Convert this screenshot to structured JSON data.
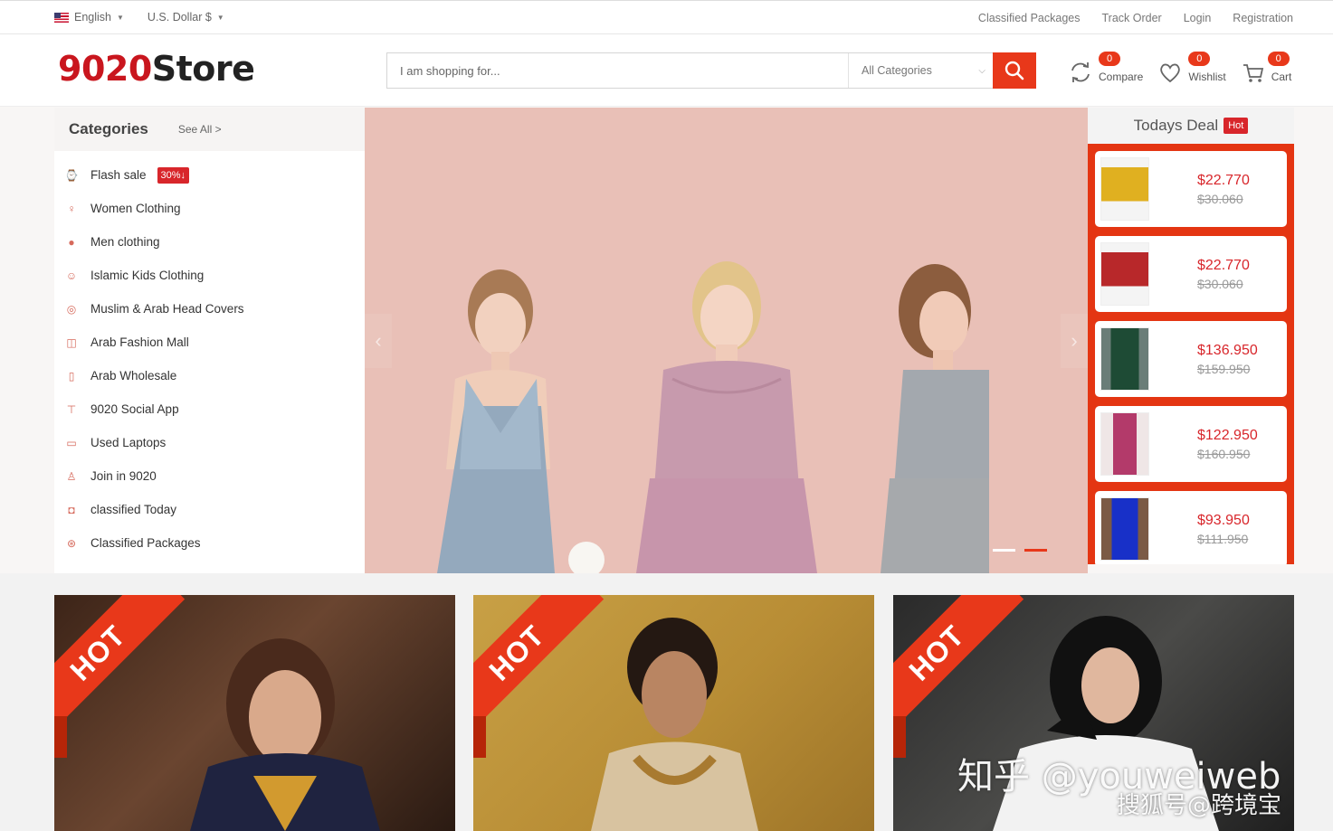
{
  "topbar": {
    "language": "English",
    "currency": "U.S. Dollar $",
    "links": [
      "Classified Packages",
      "Track Order",
      "Login",
      "Registration"
    ]
  },
  "header": {
    "logo_num": "9020",
    "logo_word": "Store",
    "search_placeholder": "I am shopping for...",
    "category_select": "All Categories",
    "compare": {
      "label": "Compare",
      "count": "0"
    },
    "wishlist": {
      "label": "Wishlist",
      "count": "0"
    },
    "cart": {
      "label": "Cart",
      "count": "0"
    }
  },
  "categories": {
    "title": "Categories",
    "see_all": "See All >",
    "flash_tag": "30%↓",
    "items": [
      {
        "label": "Flash sale",
        "icon": "watch-icon"
      },
      {
        "label": "Women Clothing",
        "icon": "woman-icon"
      },
      {
        "label": "Men clothing",
        "icon": "man-icon"
      },
      {
        "label": "Islamic Kids Clothing",
        "icon": "kid-icon"
      },
      {
        "label": "Muslim & Arab Head Covers",
        "icon": "head-cover-icon"
      },
      {
        "label": "Arab Fashion Mall",
        "icon": "bag-icon"
      },
      {
        "label": "Arab Wholesale",
        "icon": "phone-icon"
      },
      {
        "label": "9020 Social App",
        "icon": "shirt-icon"
      },
      {
        "label": "Used Laptops",
        "icon": "laptop-icon"
      },
      {
        "label": "Join in 9020",
        "icon": "dress-icon"
      },
      {
        "label": "classified Today",
        "icon": "camera-icon"
      },
      {
        "label": "Classified Packages",
        "icon": "ball-icon"
      }
    ]
  },
  "slider": {
    "slides": 2,
    "active": 2
  },
  "deal": {
    "title": "Todays Deal",
    "badge": "Hot",
    "items": [
      {
        "price": "$22.770",
        "old": "$30.060"
      },
      {
        "price": "$22.770",
        "old": "$30.060"
      },
      {
        "price": "$136.950",
        "old": "$159.950"
      },
      {
        "price": "$122.950",
        "old": "$160.950"
      },
      {
        "price": "$93.950",
        "old": "$111.950"
      }
    ]
  },
  "promos": [
    {
      "ribbon": "HOT"
    },
    {
      "ribbon": "HOT"
    },
    {
      "ribbon": "HOT"
    }
  ],
  "watermark": {
    "line1": "知乎 @youweiweb",
    "line2": "搜狐号@跨境宝"
  },
  "colors": {
    "accent": "#e8381a",
    "brand_red": "#c9161e",
    "hot": "#d8262b"
  }
}
